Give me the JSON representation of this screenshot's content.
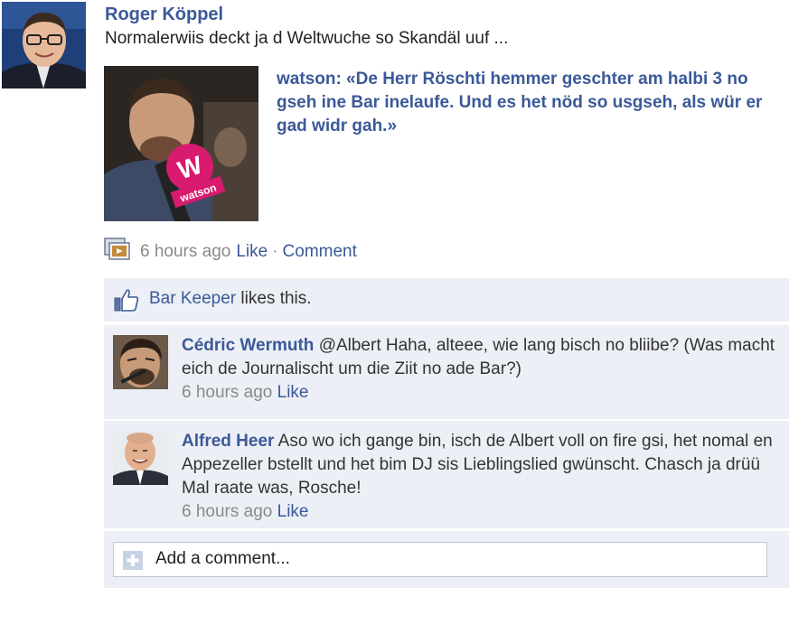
{
  "post": {
    "author": "Roger Köppel",
    "text": "Normalerwiis deckt ja d Weltwuche so Skandäl uuf ...",
    "shared_link_title": "watson: «De Herr Röschti hemmer geschter am halbi 3 no gseh ine Bar inelaufe. Und es het nöd so usgseh, als wür er gad widr gah.»",
    "thumbnail_logo_text": "W",
    "thumbnail_mic_text": "watson"
  },
  "meta": {
    "time": "6 hours ago",
    "like_label": "Like",
    "separator": "·",
    "comment_label": "Comment"
  },
  "likes": {
    "liker": "Bar Keeper",
    "suffix": "likes this."
  },
  "comments": [
    {
      "author": "Cédric Wermuth",
      "text": "@Albert Haha, alteee, wie lang bisch no bliibe? (Was macht eich de Journalischt um die Ziit no ade Bar?)",
      "time": "6 hours ago",
      "like_label": "Like"
    },
    {
      "author": "Alfred Heer",
      "text": "Aso wo ich gange bin, isch de Albert voll on fire gsi, het nomal en Appezeller bstellt und het bim DJ sis Lieblingslied gwünscht. Chasch ja drüü Mal raate was, Rosche!",
      "time": "6 hours ago",
      "like_label": "Like"
    }
  ],
  "add_comment": {
    "placeholder": "Add a comment..."
  },
  "colors": {
    "link": "#3b5998",
    "muted": "#8a8a8a",
    "panel": "#eceff5"
  }
}
